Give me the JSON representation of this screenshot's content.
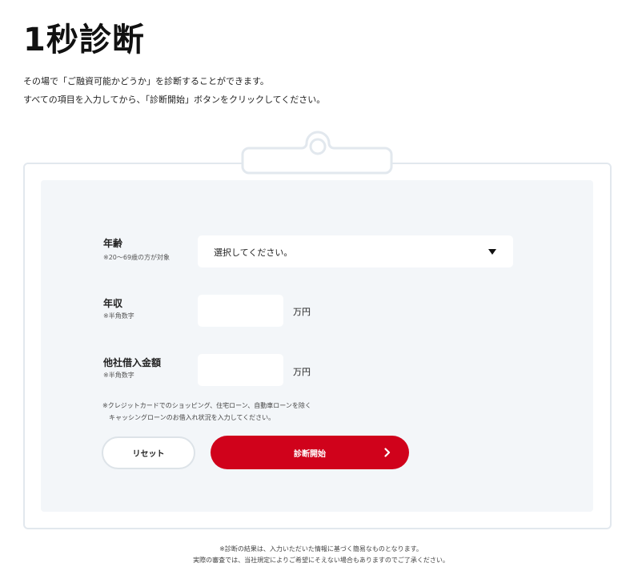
{
  "page": {
    "title": "1秒診断",
    "intro_line1": "その場で「ご融資可能かどうか」を診断することができます。",
    "intro_line2": "すべての項目を入力してから、「診断開始」ボタンをクリックしてください。"
  },
  "form": {
    "age": {
      "label": "年齢",
      "note": "※20〜69歳の方が対象",
      "selected": "選択してください。"
    },
    "income": {
      "label": "年収",
      "note": "※半角数字",
      "value": "",
      "unit": "万円"
    },
    "other_debt": {
      "label": "他社借入金額",
      "note": "※半角数字",
      "value": "",
      "unit": "万円"
    },
    "footnote_line1": "※クレジットカードでのショッピング、住宅ローン、自動車ローンを除く",
    "footnote_line2": "キャッシングローンのお借入れ状況を入力してください。",
    "reset_label": "リセット",
    "start_label": "診断開始"
  },
  "bottom": {
    "note_line1": "※診断の結果は、入力いただいた情報に基づく簡易なものとなります。",
    "note_line2": "実際の審査では、当社規定によりご希望にそえない場合もありますのでご了承ください。"
  },
  "colors": {
    "accent": "#d0021b",
    "panel_bg": "#f3f6f9",
    "border": "#e2e8ee"
  },
  "icons": {
    "select_arrow": "caret-down-icon",
    "start_chevron": "chevron-right-icon",
    "clip": "clipboard-clip-icon"
  }
}
